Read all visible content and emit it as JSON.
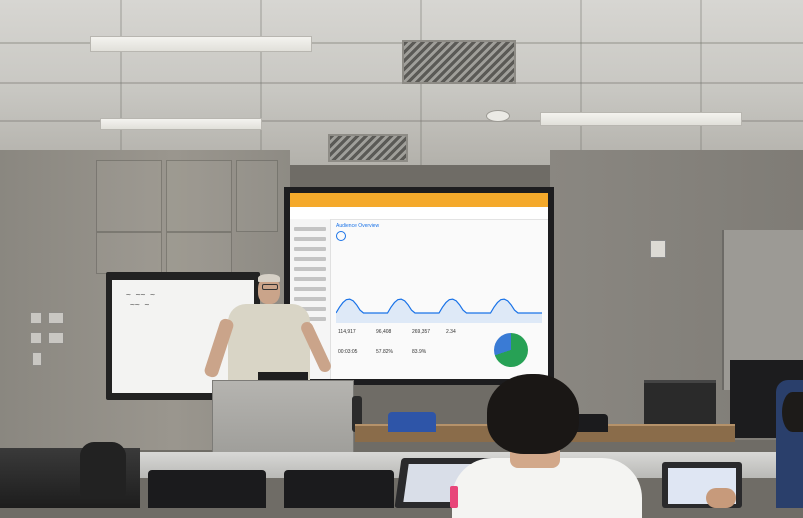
{
  "scene": {
    "description_type": "photograph",
    "colors": {
      "ceiling": "#d7d6d2",
      "wall": "#8a8780",
      "screen_frame": "#1d1d1f",
      "ga_accent": "#f4a92b",
      "chart_line": "#1a73e8",
      "podium": "#b5b4b0",
      "blue_chair": "#2e55a8"
    }
  },
  "projected_screen": {
    "page_title": "Audience Overview",
    "pie_percent": 70,
    "metrics": [
      {
        "value": "114,917"
      },
      {
        "value": "96,408"
      },
      {
        "value": "269,357"
      },
      {
        "value": "2.34"
      },
      {
        "value": "00:03:05"
      },
      {
        "value": "57.82%"
      },
      {
        "value": "83.9%"
      }
    ]
  }
}
